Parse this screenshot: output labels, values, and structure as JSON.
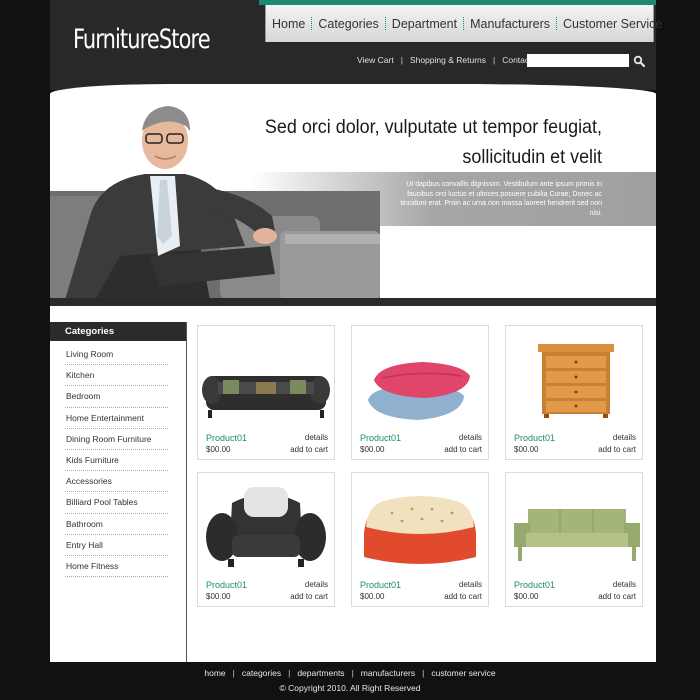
{
  "header": {
    "logo": "FurnitureStore",
    "nav": [
      {
        "label": "Home"
      },
      {
        "label": "Categories"
      },
      {
        "label": "Department"
      },
      {
        "label": "Manufacturers"
      },
      {
        "label": "Customer Service"
      }
    ],
    "util_links": [
      {
        "label": "View Cart"
      },
      {
        "label": "Shopping & Returns"
      },
      {
        "label": "Contact Us"
      }
    ],
    "search": {
      "value": "",
      "icon": "search-icon"
    },
    "accent_color": "#1f8a73"
  },
  "banner": {
    "headline_1": "Sed orci dolor, vulputate ut tempor feugiat,",
    "headline_2": "sollicitudin et velit",
    "text": "Ut dapibus convallis dignissim. Vestibulum ante ipsum primis in faucibus orci luctus et ultrices posuere cubilia Curae; Donec ac tincidunt erat. Proin ac urna non massa laoreet hendrerit sed non nisi."
  },
  "sidebar": {
    "title": "Categories",
    "items": [
      {
        "label": "Living Room"
      },
      {
        "label": "Kitchen"
      },
      {
        "label": "Bedroom"
      },
      {
        "label": "Home Entertainment"
      },
      {
        "label": "Dining Room Furniture"
      },
      {
        "label": "Kids Furniture"
      },
      {
        "label": "Accessories"
      },
      {
        "label": "Billiard Pool Tables"
      },
      {
        "label": "Bathroom"
      },
      {
        "label": "Entry Hall"
      },
      {
        "label": "Home Fitness"
      }
    ]
  },
  "products": [
    {
      "name": "Product01",
      "price": "$00.00",
      "details": "details",
      "cart": "add to cart",
      "image": "sofa-image"
    },
    {
      "name": "Product01",
      "price": "$00.00",
      "details": "details",
      "cart": "add to cart",
      "image": "pillows-image"
    },
    {
      "name": "Product01",
      "price": "$00.00",
      "details": "details",
      "cart": "add to cart",
      "image": "dresser-image"
    },
    {
      "name": "Product01",
      "price": "$00.00",
      "details": "details",
      "cart": "add to cart",
      "image": "armchair-image"
    },
    {
      "name": "Product01",
      "price": "$00.00",
      "details": "details",
      "cart": "add to cart",
      "image": "pouf-image"
    },
    {
      "name": "Product01",
      "price": "$00.00",
      "details": "details",
      "cart": "add to cart",
      "image": "green-sofa-image"
    }
  ],
  "footer": {
    "links": [
      {
        "label": "home"
      },
      {
        "label": "categories"
      },
      {
        "label": "departments"
      },
      {
        "label": "manufacturers"
      },
      {
        "label": "customer service"
      }
    ],
    "copyright": "© Copyright 2010. All Right Reserved"
  }
}
